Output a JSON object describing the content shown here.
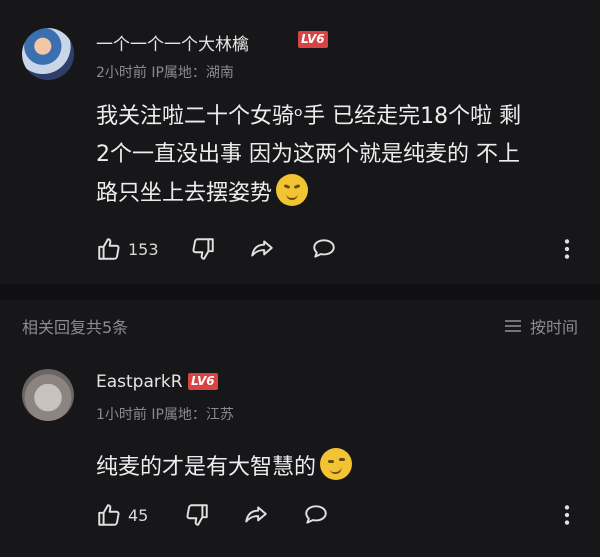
{
  "comments": [
    {
      "username": "一个一个一个大林檎",
      "level": "LV6",
      "meta": "2小时前 IP属地：湖南",
      "text_lines": [
        "我关注啦二十个女骑ᵒ手 已经走完18个啦 剩",
        "2个一直没出事 因为这两个就是纯麦的 不上",
        "路只坐上去摆姿势"
      ],
      "emoji": "laughing-crying-emoji",
      "likes": "153"
    },
    {
      "username": "EastparkR",
      "level": "LV6",
      "meta": "1小时前 IP属地：江苏",
      "text_lines": [
        "纯麦的才是有大智慧的"
      ],
      "emoji": "smirk-emoji",
      "likes": "45"
    }
  ],
  "replies_bar": {
    "label": "相关回复共5条",
    "sort_label": "按时间",
    "sort_icon": "list-icon"
  },
  "colors": {
    "background": "#17171a",
    "level_badge": "#d84343",
    "muted_text": "#8a8a8e"
  }
}
